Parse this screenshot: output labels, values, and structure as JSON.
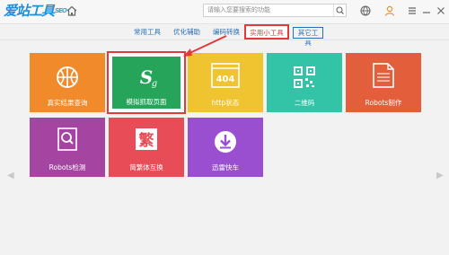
{
  "header": {
    "logo_text": "爱站工具",
    "logo_suffix": "SEO",
    "search_placeholder": "请输入您要搜索的功能"
  },
  "tabs": [
    {
      "label": "常用工具"
    },
    {
      "label": "优化辅助"
    },
    {
      "label": "编码转换"
    },
    {
      "label": "实用小工具"
    },
    {
      "label": "其它工具"
    }
  ],
  "tiles": [
    {
      "label": "真实结果查询",
      "color": "#f08a2a",
      "icon": "basketball-icon"
    },
    {
      "label": "模拟抓取页面",
      "color": "#25a45a",
      "icon": "spider-icon",
      "selected": true
    },
    {
      "label": "http状态",
      "color": "#f0c431",
      "icon": "http-status-icon"
    },
    {
      "label": "二维码",
      "color": "#33c3a6",
      "icon": "qrcode-icon"
    },
    {
      "label": "Robots制作",
      "color": "#e35e3a",
      "icon": "robots-make-icon"
    },
    {
      "label": "Robots检测",
      "color": "#a445a2",
      "icon": "robots-check-icon"
    },
    {
      "label": "简繁体互换",
      "color": "#e84d57",
      "icon": "fanjian-icon"
    },
    {
      "label": "迅雷快车",
      "color": "#9a4fd0",
      "icon": "download-icon"
    }
  ],
  "colors": {
    "accent": "#e03a3a",
    "tab_text": "#2a6fb4"
  }
}
